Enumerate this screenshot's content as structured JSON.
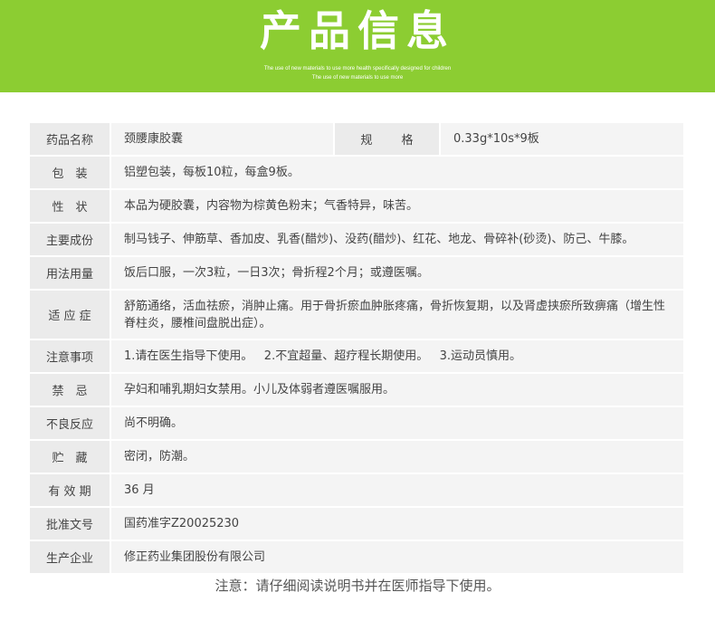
{
  "banner": {
    "title": "产品信息",
    "subtitle_1": "The use of new materials to use more health specifically designed for children",
    "subtitle_2": "The use of new materials to use more",
    "color": "#8ccd32"
  },
  "table": {
    "rows": [
      {
        "label": "药品名称",
        "value": "颈腰康胶囊",
        "spec_label": "规  格",
        "spec_value": "0.33g*10s*9板"
      },
      {
        "label": "包　装",
        "value": "铝塑包装，每板10粒，每盒9板。"
      },
      {
        "label": "性　状",
        "value": "本品为硬胶囊，内容物为棕黄色粉末；气香特异，味苦。"
      },
      {
        "label": "主要成份",
        "value": "制马钱子、伸筋草、香加皮、乳香(醋炒)、没药(醋炒)、红花、地龙、骨碎补(砂烫)、防己、牛膝。"
      },
      {
        "label": "用法用量",
        "value": "饭后口服，一次3粒，一日3次；骨折程2个月；或遵医嘱。"
      },
      {
        "label": "适 应 症",
        "value": "舒筋通络，活血祛瘀，消肿止痛。用于骨折瘀血肿胀疼痛，骨折恢复期，以及肾虚挟瘀所致痹痛（增生性脊柱炎，腰椎间盘脱出症）。"
      },
      {
        "label": "注意事项",
        "value": "1.请在医生指导下使用。   2.不宜超量、超疗程长期使用。   3.运动员慎用。"
      },
      {
        "label": "禁　忌",
        "value": "孕妇和哺乳期妇女禁用。小儿及体弱者遵医嘱服用。"
      },
      {
        "label": "不良反应",
        "value": "尚不明确。"
      },
      {
        "label": "贮　藏",
        "value": "密闭，防潮。"
      },
      {
        "label": "有 效 期",
        "value": "36 月"
      },
      {
        "label": "批准文号",
        "value": "国药准字Z20025230"
      },
      {
        "label": "生产企业",
        "value": "修正药业集团股份有限公司"
      }
    ]
  },
  "footer": "注意：请仔细阅读说明书并在医师指导下使用。"
}
